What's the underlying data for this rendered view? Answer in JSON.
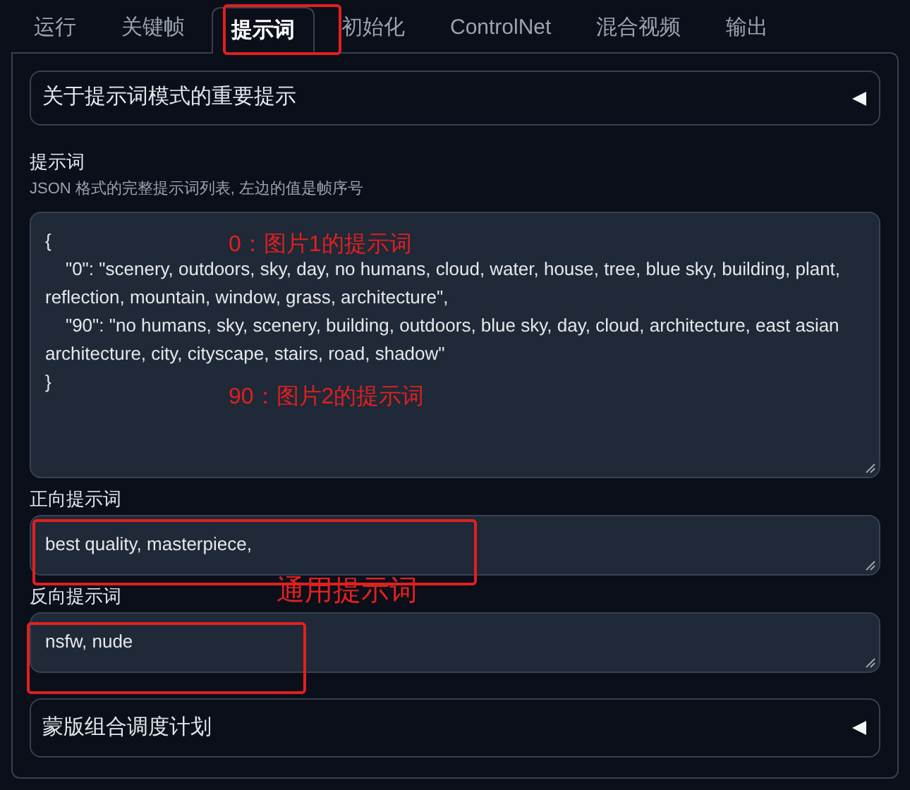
{
  "tabs": [
    {
      "label": "运行",
      "selected": false
    },
    {
      "label": "关键帧",
      "selected": false
    },
    {
      "label": "提示词",
      "selected": true
    },
    {
      "label": "初始化",
      "selected": false
    },
    {
      "label": "ControlNet",
      "selected": false
    },
    {
      "label": "混合视频",
      "selected": false
    },
    {
      "label": "输出",
      "selected": false
    }
  ],
  "top_accordion": {
    "title": "关于提示词模式的重要提示",
    "expanded": false
  },
  "prompts": {
    "label": "提示词",
    "hint": "JSON 格式的完整提示词列表, 左边的值是帧序号",
    "value": "{\n    \"0\": \"scenery, outdoors, sky, day, no humans, cloud, water, house, tree, blue sky, building, plant, reflection, mountain, window, grass, architecture\",\n    \"90\": \"no humans, sky, scenery, building, outdoors, blue sky, day, cloud, architecture, east asian architecture, city, cityscape, stairs, road, shadow\"\n}"
  },
  "positive": {
    "label": "正向提示词",
    "value": "best quality, masterpiece,"
  },
  "negative": {
    "label": "反向提示词",
    "value": "nsfw, nude"
  },
  "bottom_accordion": {
    "title": "蒙版组合调度计划",
    "expanded": false
  },
  "annotations": [
    {
      "kind": "text",
      "text": "0：图片1的提示词"
    },
    {
      "kind": "text",
      "text": "90：图片2的提示词"
    },
    {
      "kind": "text",
      "text": "通用提示词"
    },
    {
      "kind": "box"
    },
    {
      "kind": "box"
    },
    {
      "kind": "box"
    }
  ]
}
